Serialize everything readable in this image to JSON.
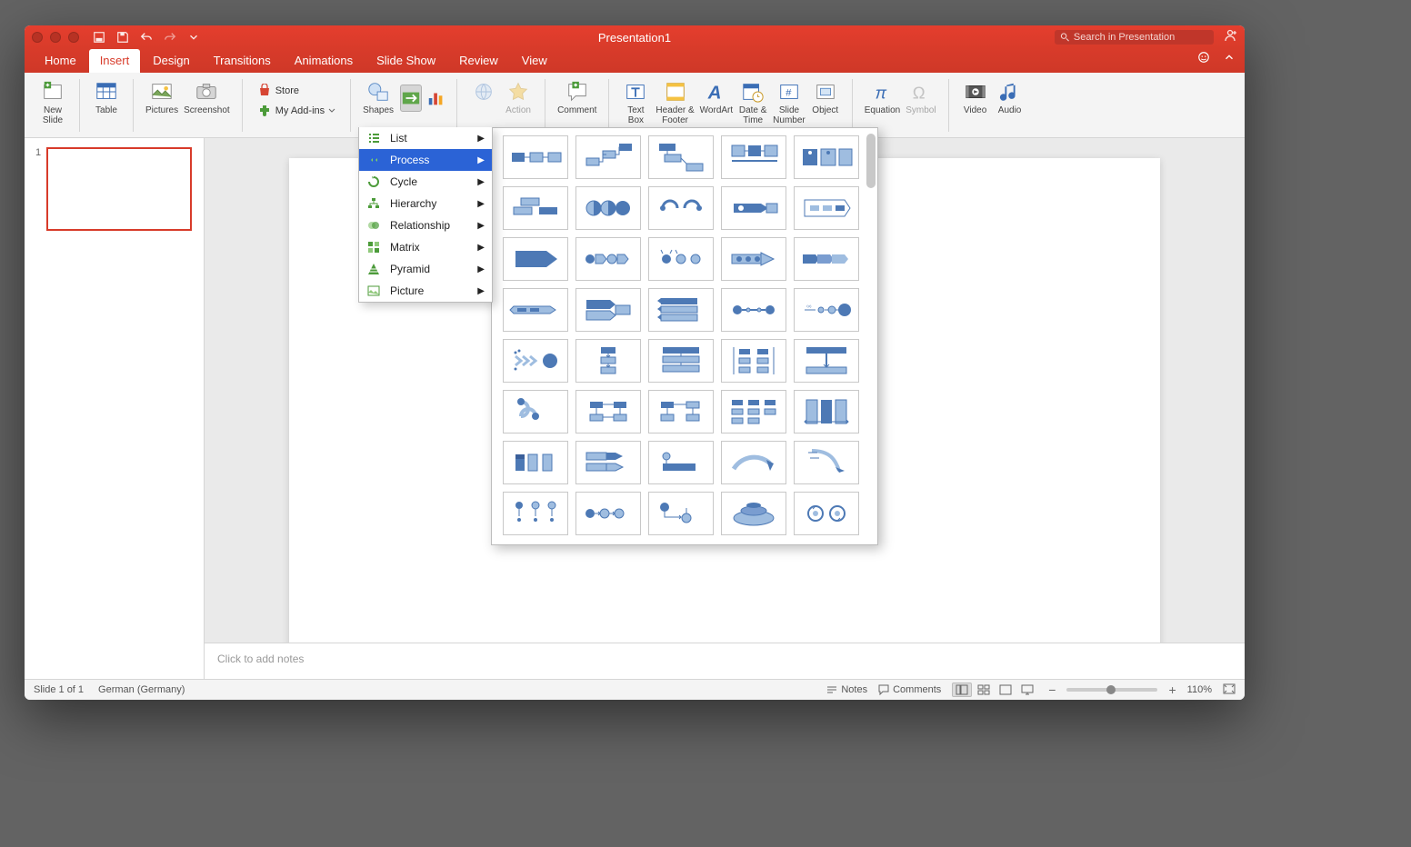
{
  "title": "Presentation1",
  "search_placeholder": "Search in Presentation",
  "tabs": [
    "Home",
    "Insert",
    "Design",
    "Transitions",
    "Animations",
    "Slide Show",
    "Review",
    "View"
  ],
  "active_tab": 1,
  "ribbon": {
    "new_slide": "New\nSlide",
    "table": "Table",
    "pictures": "Pictures",
    "screenshot": "Screenshot",
    "store": "Store",
    "my_addins": "My Add-ins",
    "shapes": "Shapes",
    "action": "Action",
    "comment": "Comment",
    "text_box": "Text\nBox",
    "header_footer": "Header &\nFooter",
    "wordart": "WordArt",
    "date_time": "Date &\nTime",
    "slide_num": "Slide\nNumber",
    "object": "Object",
    "equation": "Equation",
    "symbol": "Symbol",
    "video": "Video",
    "audio": "Audio"
  },
  "smartart_menu": [
    "List",
    "Process",
    "Cycle",
    "Hierarchy",
    "Relationship",
    "Matrix",
    "Pyramid",
    "Picture"
  ],
  "smartart_selected": 1,
  "gallery_count": 40,
  "thumbnail_number": "1",
  "notes_placeholder": "Click to add notes",
  "status": {
    "slide": "Slide 1 of 1",
    "lang": "German (Germany)",
    "notes": "Notes",
    "comments": "Comments",
    "zoom": "110%"
  }
}
